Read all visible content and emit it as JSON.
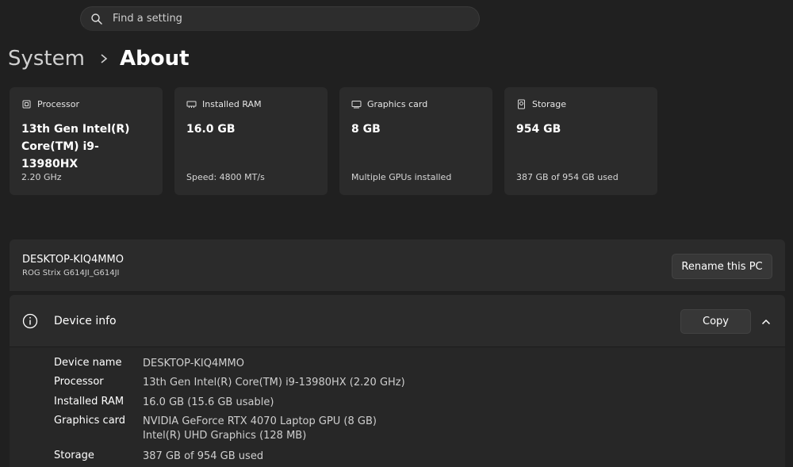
{
  "search": {
    "placeholder": "Find a setting"
  },
  "breadcrumb": {
    "parent": "System",
    "current": "About"
  },
  "tiles": [
    {
      "header": "Processor",
      "icon": "processor-icon",
      "value": "13th Gen Intel(R)\nCore(TM) i9-13980HX",
      "sub": "2.20 GHz"
    },
    {
      "header": "Installed RAM",
      "icon": "ram-icon",
      "value": "16.0 GB",
      "sub": "Speed: 4800 MT/s"
    },
    {
      "header": "Graphics card",
      "icon": "graphics-card-icon",
      "value": "8 GB",
      "sub": "Multiple GPUs installed"
    },
    {
      "header": "Storage",
      "icon": "storage-icon",
      "value": "954 GB",
      "sub": "387 GB of 954 GB used"
    }
  ],
  "pc": {
    "name": "DESKTOP-KIQ4MMO",
    "model": "ROG Strix G614JI_G614JI",
    "rename_label": "Rename this PC"
  },
  "device_info": {
    "title": "Device info",
    "copy_label": "Copy",
    "rows": [
      {
        "label": "Device name",
        "value": "DESKTOP-KIQ4MMO"
      },
      {
        "label": "Processor",
        "value": "13th Gen Intel(R) Core(TM) i9-13980HX (2.20 GHz)"
      },
      {
        "label": "Installed RAM",
        "value": "16.0 GB (15.6 GB usable)"
      },
      {
        "label": "Graphics card",
        "value": "NVIDIA GeForce RTX 4070 Laptop GPU (8 GB)",
        "value2": "Intel(R) UHD Graphics (128 MB)"
      },
      {
        "label": "Storage",
        "value": "387 GB of 954 GB used"
      }
    ]
  },
  "colors": {
    "background": "#202020",
    "card": "#2b2b2b",
    "button": "#373737",
    "text": "#ffffff",
    "muted_text": "#cfcfcf"
  }
}
